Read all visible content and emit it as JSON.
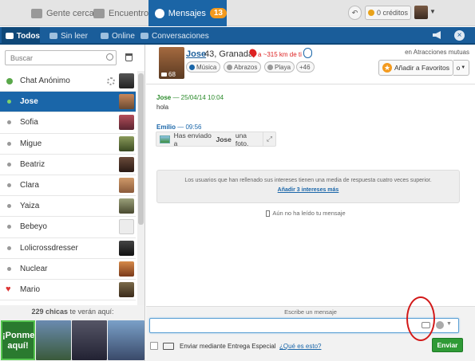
{
  "topnav": {
    "nearby": "Gente cerca",
    "encounters": "Encuentros",
    "messages": "Mensajes",
    "messages_badge": "13",
    "credits": "0 créditos"
  },
  "subnav": {
    "all": "Todos",
    "unread": "Sin leer",
    "online": "Online",
    "conversations": "Conversaciones"
  },
  "sidebar": {
    "search_placeholder": "Buscar",
    "contacts": [
      {
        "name": "Chat Anónimo"
      },
      {
        "name": "Jose"
      },
      {
        "name": "Sofia"
      },
      {
        "name": "Migue"
      },
      {
        "name": "Beatriz"
      },
      {
        "name": "Clara"
      },
      {
        "name": "Yaiza"
      },
      {
        "name": "Bebeyo"
      },
      {
        "name": "Lolicrossdresser"
      },
      {
        "name": "Nuclear"
      },
      {
        "name": "Mario"
      }
    ],
    "promo_count": "229 chicas",
    "promo_suffix": "te verán aquí:",
    "promo_cta": "¡Ponme aquí!"
  },
  "profile": {
    "name": "Jose",
    "info": "43, Granada",
    "distance": "a ~315 km de ti",
    "photos": "68",
    "tags": [
      "Música",
      "Abrazos",
      "Playa",
      "+46"
    ],
    "mutual": "en Atracciones mutuas",
    "favorite": "Añadir a Favoritos",
    "favorite_menu": "o"
  },
  "chat": {
    "msg1_author": "Jose",
    "msg1_time": " — 25/04/14 10:04",
    "msg1_text": "hola",
    "msg2_author": "Emilio",
    "msg2_time": " — 09:56",
    "photo_prefix": "Has enviado a",
    "photo_name": "Jose",
    "photo_suffix": "una foto.",
    "info_text": "Los usuarios que han rellenado sus intereses tienen una media de respuesta cuatro veces superior.",
    "info_link": "Añadir 3 intereses más",
    "unread_note": "Aún no ha leído tu mensaje"
  },
  "compose": {
    "label": "Escribe un mensaje",
    "special_label": "Enviar mediante Entrega Especial",
    "special_link": "¿Qué es esto?",
    "send": "Enviar"
  },
  "colors": {
    "primary": "#1b65a6",
    "badge": "#f39a1e",
    "send": "#2f9a36",
    "annotation": "#d21818"
  }
}
